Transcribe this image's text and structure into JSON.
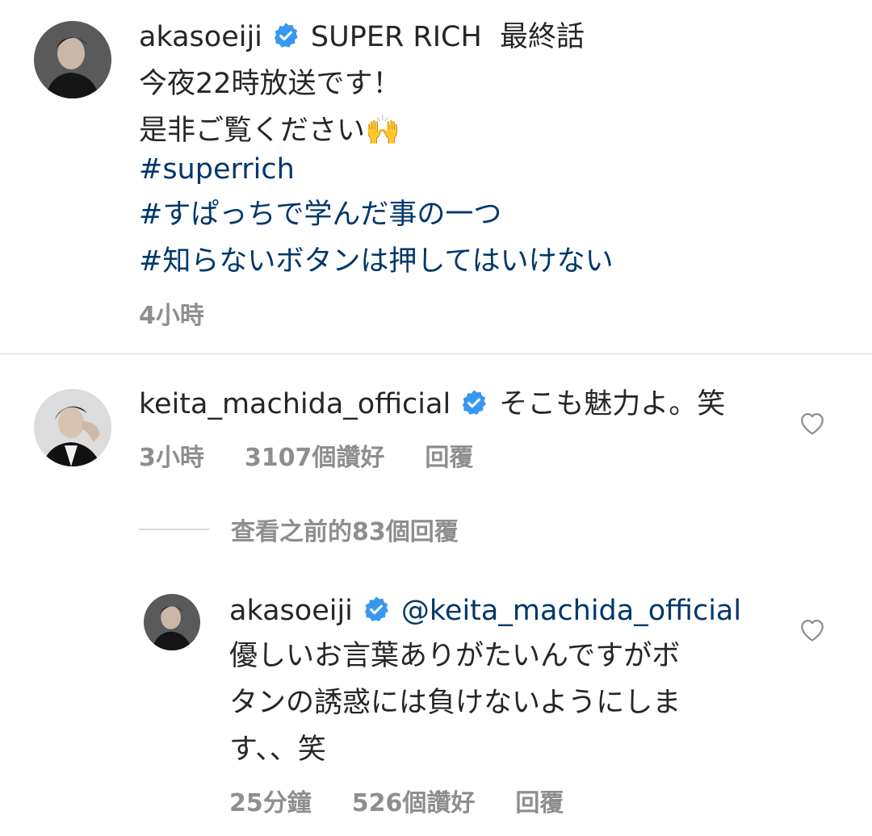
{
  "post": {
    "username": "akasoeiji",
    "title_text": "SUPER RICH  最終話",
    "caption_lines": [
      "今夜22時放送です！",
      "是非ご覧ください🙌"
    ],
    "hashtags": [
      "#superrich",
      "#すぱっちで学んだ事の一つ",
      "#知らないボタンは押してはいけない"
    ],
    "time": "4小時"
  },
  "comment": {
    "username": "keita_machida_official",
    "text": "そこも魅力よ。笑",
    "time": "3小時",
    "likes": "3107個讚好",
    "reply_label": "回覆"
  },
  "view_previous": "查看之前的83個回覆",
  "reply": {
    "username": "akasoeiji",
    "mention": "@keita_machida_official",
    "text_lines": [
      "優しいお言葉ありがたいんですがボ",
      "タンの誘惑には負けないようにしま",
      "す、、笑"
    ],
    "time": "25分鐘",
    "likes": "526個讚好",
    "reply_label": "回覆"
  },
  "colors": {
    "link": "#00376b",
    "verified": "#3897f0",
    "meta": "#8e8e8e",
    "divider": "#dbdbdb"
  },
  "icons": [
    "verified-badge-icon",
    "heart-icon",
    "hands-raised-emoji"
  ]
}
